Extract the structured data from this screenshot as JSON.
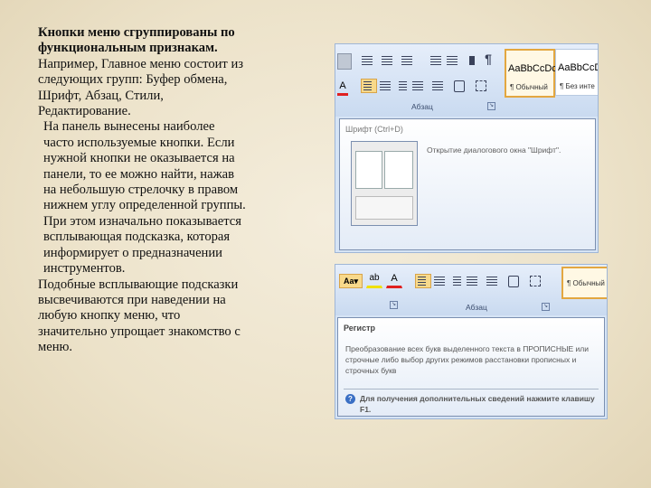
{
  "slide": {
    "paragraph1_bold": "Кнопки меню сгруппированы по функциональным признакам.",
    "paragraph1_rest": " Например, Главное меню состоит из следующих групп: Буфер обмена, Шрифт, Абзац, Стили, Редактирование.",
    "paragraph2": "На панель вынесены наиболее часто используемые кнопки. Если нужной кнопки не оказывается на панели, то ее можно найти, нажав на небольшую стрелочку в правом нижнем углу определенной группы. При этом изначально показывается всплывающая подсказка, которая информирует о предназначении инструментов.",
    "paragraph3": "Подобные всплывающие подсказки высвечиваются при наведении на любую кнопку меню, что значительно упрощает знакомство с меню."
  },
  "shot1": {
    "group_label": "Абзац",
    "style1": "AaBbCcDc",
    "style1_name": "¶ Обычный",
    "style2": "AaBbCcDc",
    "style2_name": "¶ Без инте",
    "tooltip_title": "Шрифт (Ctrl+D)",
    "tooltip_desc": "Открытие диалогового окна \"Шрифт\"."
  },
  "shot2": {
    "group_label": "Абзац",
    "style1_name": "¶ Обычный",
    "tooltip_title": "Регистр",
    "tooltip_desc": "Преобразование всех букв выделенного текста в ПРОПИСНЫЕ или строчные либо выбор других режимов расстановки прописных и строчных букв",
    "tooltip_help": "Для получения дополнительных сведений нажмите клавишу F1."
  },
  "colors": {
    "selected": "#f8d98b",
    "ribbon": "#c9daf0",
    "paper": "#ece2c9"
  }
}
